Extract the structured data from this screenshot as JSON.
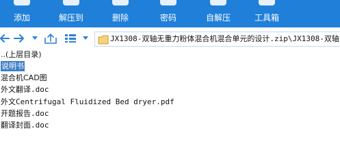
{
  "toolbar": {
    "buttons": [
      {
        "label": "添加",
        "icon": "add-icon"
      },
      {
        "label": "解压到",
        "icon": "extract-to-icon"
      },
      {
        "label": "删除",
        "icon": "delete-icon"
      },
      {
        "label": "密码",
        "icon": "password-icon"
      },
      {
        "label": "自解压",
        "icon": "self-extract-icon"
      },
      {
        "label": "工具箱",
        "icon": "toolbox-icon"
      }
    ]
  },
  "nav": {
    "back_icon": "back-arrow-icon",
    "forward_icon": "forward-arrow-icon",
    "up_icon": "folder-up-icon",
    "view_icon": "view-mode-icon",
    "dropdown_icon": "chevron-down-icon"
  },
  "address": {
    "path": "JX1308-双轴无重力粉体混合机混合单元的设计.zip\\JX1308-双轴"
  },
  "files": [
    {
      "name": "..(上层目录)",
      "selected": false
    },
    {
      "name": "说明书",
      "selected": true
    },
    {
      "name": "混合机CAD图",
      "selected": false
    },
    {
      "name": "外文翻译.doc",
      "selected": false
    },
    {
      "name": "外文Centrifugal Fluidized Bed dryer.pdf",
      "selected": false
    },
    {
      "name": "开题报告.doc",
      "selected": false
    },
    {
      "name": "翻译封面.doc",
      "selected": false
    }
  ],
  "colors": {
    "toolbar_bg": "#1f7fd9",
    "selection_bg": "#3d7fc7",
    "accent_icon": "#2a7fd6"
  }
}
